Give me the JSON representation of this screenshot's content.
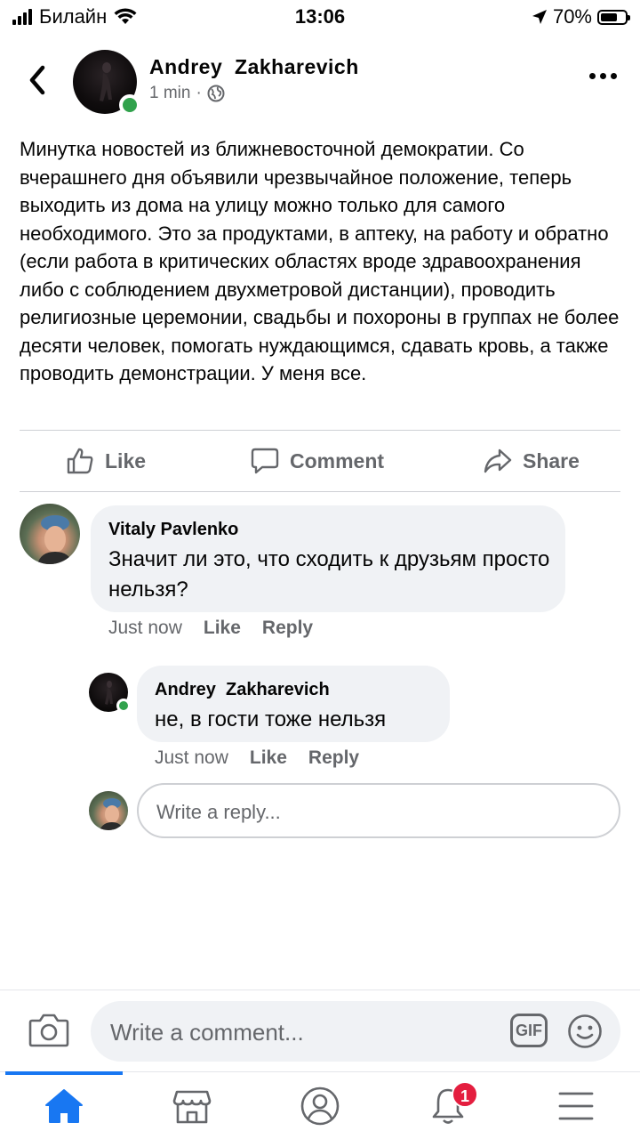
{
  "status_bar": {
    "carrier": "Билайн",
    "time": "13:06",
    "battery": "70%",
    "battery_level": 0.7,
    "icons": [
      "signal-icon",
      "wifi-icon",
      "location-arrow-icon",
      "battery-icon"
    ]
  },
  "post": {
    "author": "Andrey  Zakharevich",
    "time": "1 min",
    "separator": "·",
    "audience_icon": "globe-icon",
    "text": "Минутка новостей из ближневосточной демократии. Со вчерашнего дня объявили чрезвычайное положение, теперь выходить из дома на улицу можно только для самого необходимого. Это за продуктами, в аптеку, на работу и обратно (если работа в критических областях вроде здравоохранения либо с соблюдением двухметровой дистанции), проводить религиозные церемонии, свадьбы и похороны в группах не более десяти человек, помогать нуждающимся, сдавать кровь, а также проводить демонстрации. У меня все."
  },
  "actions": {
    "like": "Like",
    "comment": "Comment",
    "share": "Share"
  },
  "comments": [
    {
      "author": "Vitaly Pavlenko",
      "text": "Значит ли это, что сходить к друзьям просто нельзя?",
      "time": "Just now",
      "like": "Like",
      "reply": "Reply"
    },
    {
      "author": "Andrey  Zakharevich",
      "text": "не, в гости тоже нельзя",
      "time": "Just now",
      "like": "Like",
      "reply": "Reply"
    }
  ],
  "reply_box": {
    "placeholder": "Write a reply..."
  },
  "composer": {
    "placeholder": "Write a comment...",
    "gif_label": "GIF"
  },
  "tabbar": {
    "notification_count": "1",
    "active_tab": "home",
    "accent": "#1877f2",
    "badge_color": "#e41e3f"
  },
  "colors": {
    "online": "#31a24c",
    "secondary_text": "#65676b",
    "bubble": "#f0f2f5"
  }
}
